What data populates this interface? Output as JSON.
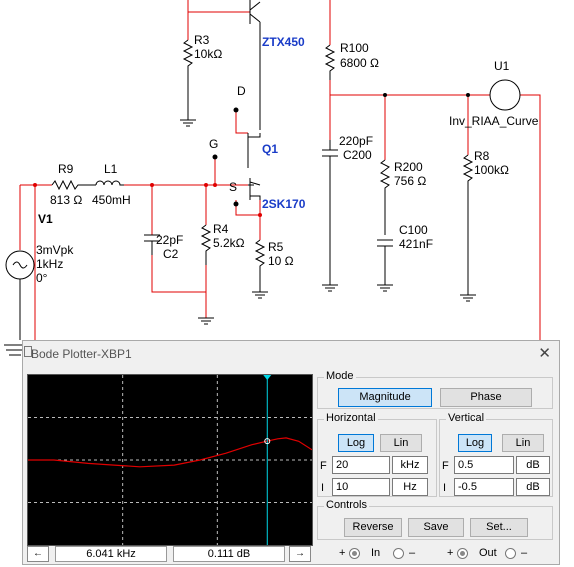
{
  "schematic": {
    "components": {
      "r3_name": "R3",
      "r3_value": "10kΩ",
      "q_top_part": "ZTX450",
      "r100_name": "R100",
      "r100_value": "6800 Ω",
      "u1_name": "U1",
      "u1_part": "Inv_RIAA_Curve",
      "d_label": "D",
      "g_label": "G",
      "s_label": "S",
      "q1_name": "Q1",
      "q1_part": "2SK170",
      "c_220_value": "220pF",
      "c_220_name": "C200",
      "r200_name": "R200",
      "r200_value": "756 Ω",
      "r8_name": "R8",
      "r8_value": "100kΩ",
      "r9_name": "R9",
      "r9_value": "813 Ω",
      "l1_name": "L1",
      "l1_value": "450mH",
      "v1_name": "V1",
      "v1_amp": "3mVpk",
      "v1_freq": "1kHz",
      "v1_phase": "0°",
      "c2_value": "22pF",
      "c2_name": "C2",
      "r4_name": "R4",
      "r4_value": "5.2kΩ",
      "r5_name": "R5",
      "r5_value": "10 Ω",
      "c100_name": "C100",
      "c100_value": "421nF"
    },
    "colors": {
      "wire": "#e00000",
      "part": "#000000",
      "label_blue": "#1a3cc8"
    }
  },
  "bode": {
    "title": "Bode Plotter-XBP1",
    "close_icon": "close-icon",
    "mode": {
      "title": "Mode",
      "magnitude": "Magnitude",
      "phase": "Phase",
      "selected": "Magnitude"
    },
    "horizontal": {
      "title": "Horizontal",
      "log": "Log",
      "lin": "Lin",
      "selected": "Log",
      "f_label": "F",
      "f_value": "20",
      "f_unit": "kHz",
      "i_label": "I",
      "i_value": "10",
      "i_unit": "Hz"
    },
    "vertical": {
      "title": "Vertical",
      "log": "Log",
      "lin": "Lin",
      "selected": "Log",
      "f_label": "F",
      "f_value": "0.5",
      "f_unit": "dB",
      "i_label": "I",
      "i_value": "-0.5",
      "i_unit": "dB"
    },
    "controls": {
      "title": "Controls",
      "reverse": "Reverse",
      "save": "Save",
      "set": "Set..."
    },
    "status": {
      "left_arrow": "←",
      "right_arrow": "→",
      "freq": "6.041 kHz",
      "gain": "0.111 dB",
      "in_plus": "+",
      "in_label": "In",
      "in_minus": "–",
      "out_plus": "+",
      "out_label": "Out",
      "out_minus": "–"
    }
  },
  "chart_data": {
    "type": "line",
    "x_scale": "log",
    "xlim_hz": [
      10,
      20000
    ],
    "ylim_db": [
      -0.5,
      0.5
    ],
    "grid": true,
    "trace_color": "#e00000",
    "cursor_color": "#00d8e8",
    "cursor": {
      "x_hz": 6041,
      "y_db": 0.111
    },
    "series": [
      {
        "x": [
          10,
          20,
          50,
          100,
          200,
          500,
          1000,
          2000,
          4000,
          6041,
          8000,
          10000,
          14000,
          20000
        ],
        "y": [
          0.0,
          0.0,
          -0.02,
          -0.03,
          -0.04,
          -0.03,
          0.0,
          0.04,
          0.09,
          0.111,
          0.125,
          0.13,
          0.11,
          0.06
        ]
      }
    ]
  }
}
